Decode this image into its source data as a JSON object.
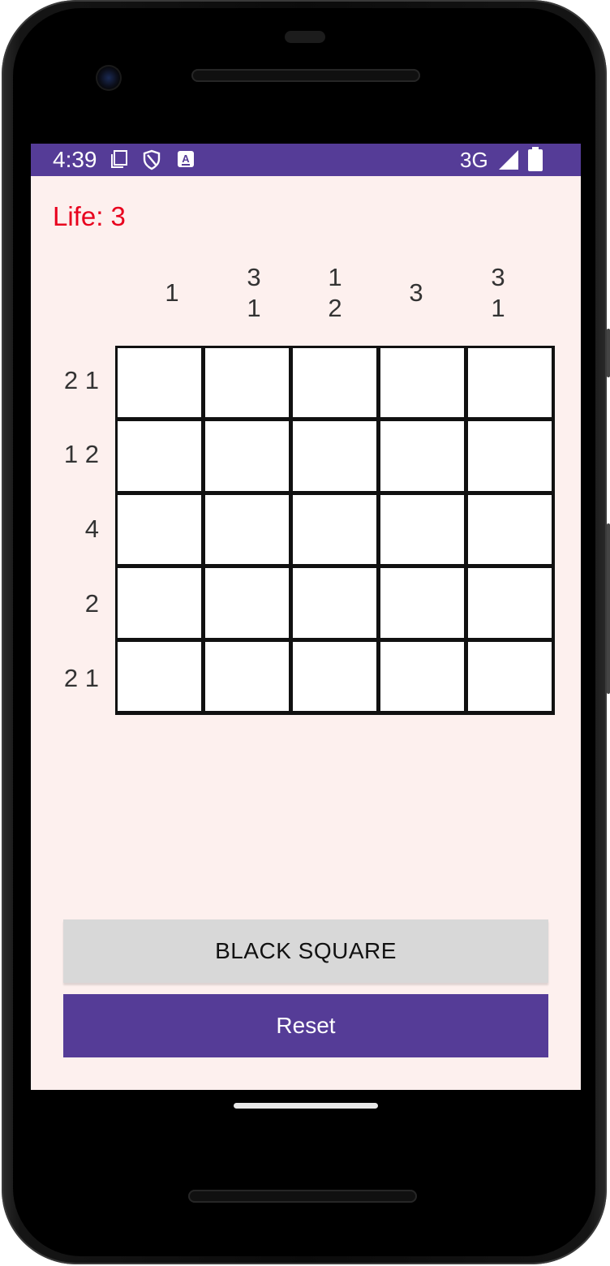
{
  "status_bar": {
    "time": "4:39",
    "network": "3G",
    "icons": [
      "notification-square-icon",
      "shield-icon",
      "keyboard-a-icon",
      "signal-icon",
      "battery-icon"
    ],
    "background_color": "#553c97"
  },
  "game": {
    "life_text": "Life: 3",
    "life_color": "#e8001d",
    "column_clues": [
      [
        "1"
      ],
      [
        "3",
        "1"
      ],
      [
        "1",
        "2"
      ],
      [
        "3"
      ],
      [
        "3",
        "1"
      ]
    ],
    "row_clues": [
      "2 1",
      "1 2",
      "4",
      "2",
      "2 1"
    ],
    "grid_size": 5,
    "cells_filled": [
      [
        false,
        false,
        false,
        false,
        false
      ],
      [
        false,
        false,
        false,
        false,
        false
      ],
      [
        false,
        false,
        false,
        false,
        false
      ],
      [
        false,
        false,
        false,
        false,
        false
      ],
      [
        false,
        false,
        false,
        false,
        false
      ]
    ]
  },
  "buttons": {
    "black_square_label": "BLACK SQUARE",
    "reset_label": "Reset"
  },
  "colors": {
    "screen_background": "#fdf0ee",
    "accent": "#553c97"
  }
}
